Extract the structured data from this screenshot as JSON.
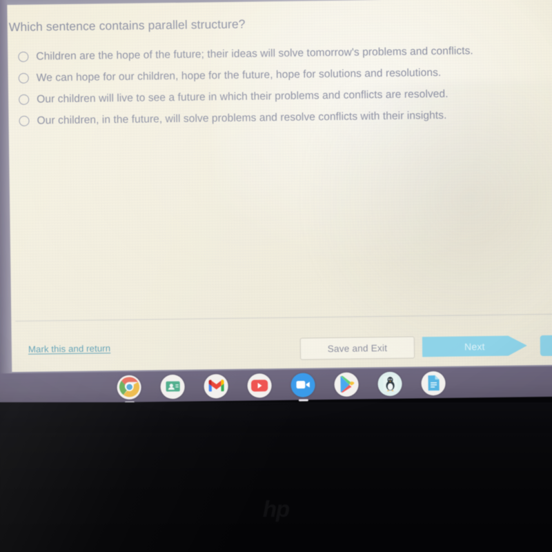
{
  "question": {
    "title": "Which sentence contains parallel structure?",
    "options": [
      {
        "id": "opt-a",
        "text": "Children are the hope of the future; their ideas will solve tomorrow's problems and conflicts.",
        "selected": false
      },
      {
        "id": "opt-b",
        "text": "We can hope for our children, hope for the future, hope for solutions and resolutions.",
        "selected": false
      },
      {
        "id": "opt-c",
        "text": "Our children will live to see a future in which their problems and conflicts are resolved.",
        "selected": false
      },
      {
        "id": "opt-d",
        "text": "Our children, in the future, will solve problems and resolve conflicts with their insights.",
        "selected": false
      }
    ]
  },
  "footer": {
    "mark_link": "Mark this and return",
    "save_exit_label": "Save and Exit",
    "next_label": "Next"
  },
  "shelf": {
    "items": [
      {
        "icon": "chrome-icon",
        "label": "Google Chrome",
        "active": true
      },
      {
        "icon": "contacts-icon",
        "label": "Contacts",
        "active": false
      },
      {
        "icon": "gmail-icon",
        "label": "Gmail",
        "active": false
      },
      {
        "icon": "youtube-icon",
        "label": "YouTube",
        "active": false
      },
      {
        "icon": "zoom-icon",
        "label": "Zoom",
        "active": true
      },
      {
        "icon": "play-store-icon",
        "label": "Play Store",
        "active": false
      },
      {
        "icon": "linux-penguin-icon",
        "label": "Terminal",
        "active": false
      },
      {
        "icon": "google-docs-icon",
        "label": "Google Docs",
        "active": false
      }
    ]
  },
  "device": {
    "brand_logo": "hp"
  },
  "colors": {
    "page_background": "#f3efde",
    "text_muted": "#8a8ea1",
    "link_teal": "#5e9fb4",
    "next_button": "#8ed3e8",
    "shelf_background": "#6a6379",
    "bezel_dark": "#07070a"
  }
}
